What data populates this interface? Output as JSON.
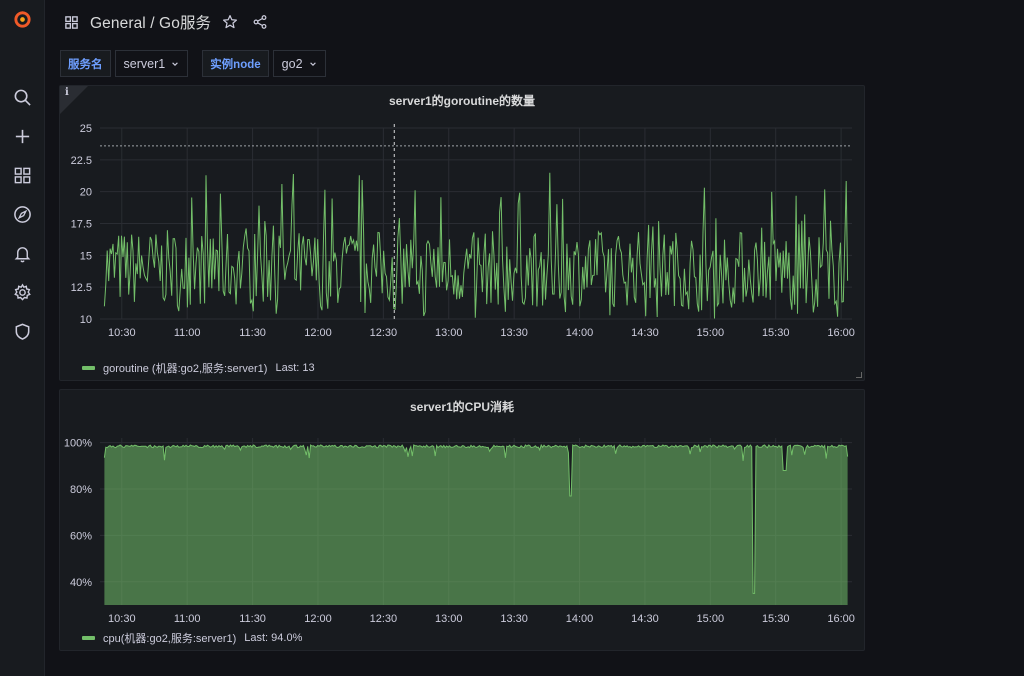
{
  "header": {
    "breadcrumb": "General / Go服务"
  },
  "variables": [
    {
      "label": "服务名",
      "value": "server1"
    },
    {
      "label": "实例node",
      "value": "go2"
    }
  ],
  "panels": {
    "goroutine": {
      "title": "server1的goroutine的数量",
      "legend_name": "goroutine (机器:go2,服务:server1)",
      "legend_last": "Last: 13"
    },
    "cpu": {
      "title": "server1的CPU消耗",
      "legend_name": "cpu(机器:go2,服务:server1)",
      "legend_last": "Last: 94.0%"
    }
  },
  "chart_data": [
    {
      "type": "line",
      "title": "server1的goroutine的数量",
      "x_ticks": [
        "10:30",
        "11:00",
        "11:30",
        "12:00",
        "12:30",
        "13:00",
        "13:30",
        "14:00",
        "14:30",
        "15:00",
        "15:30",
        "16:00"
      ],
      "y_ticks": [
        "10",
        "12.5",
        "15",
        "17.5",
        "20",
        "22.5",
        "25"
      ],
      "ylim": [
        10,
        25
      ],
      "xlim": [
        "10:20",
        "16:05"
      ],
      "series": [
        {
          "name": "goroutine (机器:go2,服务:server1)",
          "color": "#73bf69",
          "typical_range": [
            11,
            17
          ],
          "peak": 23,
          "last": 13
        }
      ],
      "threshold_line": 23.6,
      "crosshair_time": "12:35",
      "grid": true,
      "legend": "bottom-left"
    },
    {
      "type": "area",
      "title": "server1的CPU消耗",
      "x_ticks": [
        "10:30",
        "11:00",
        "11:30",
        "12:00",
        "12:30",
        "13:00",
        "13:30",
        "14:00",
        "14:30",
        "15:00",
        "15:30",
        "16:00"
      ],
      "y_ticks": [
        "40%",
        "60%",
        "80%",
        "100%"
      ],
      "ylim": [
        30,
        102
      ],
      "xlim": [
        "10:20",
        "16:05"
      ],
      "series": [
        {
          "name": "cpu(机器:go2,服务:server1)",
          "color": "#73bf69",
          "baseline": 99,
          "dips": [
            {
              "time": "13:56",
              "value": 77
            },
            {
              "time": "15:20",
              "value": 35
            },
            {
              "time": "15:34",
              "value": 88
            }
          ],
          "last": 94.0
        }
      ],
      "grid": true,
      "legend": "bottom-left"
    }
  ]
}
